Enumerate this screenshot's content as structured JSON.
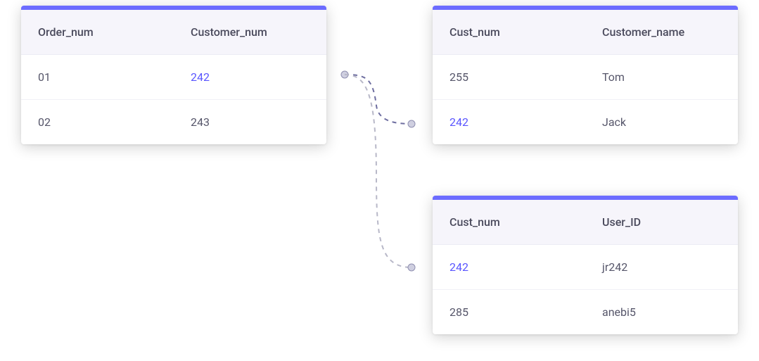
{
  "colors": {
    "accent": "#6c6cff",
    "link": "#5a56ff",
    "header_bg": "#f6f5fb",
    "text": "#56566a"
  },
  "tables": {
    "orders": {
      "columns": [
        "Order_num",
        "Customer_num"
      ],
      "rows": [
        {
          "c0": "01",
          "c1": "242",
          "c1_link": true
        },
        {
          "c0": "02",
          "c1": "243",
          "c1_link": false
        }
      ]
    },
    "customers": {
      "columns": [
        "Cust_num",
        "Customer_name"
      ],
      "rows": [
        {
          "c0": "255",
          "c1": "Tom",
          "c0_link": false
        },
        {
          "c0": "242",
          "c1": "Jack",
          "c0_link": true
        }
      ]
    },
    "users": {
      "columns": [
        "Cust_num",
        "User_ID"
      ],
      "rows": [
        {
          "c0": "242",
          "c1": "jr242",
          "c0_link": true
        },
        {
          "c0": "285",
          "c1": "anebi5",
          "c0_link": false
        }
      ]
    }
  },
  "connectors": [
    {
      "from": "orders.row0.c1",
      "to": "customers.row1.c0",
      "style": "dashed"
    },
    {
      "from": "orders.row0.c1",
      "to": "users.row0.c0",
      "style": "dashed"
    }
  ]
}
